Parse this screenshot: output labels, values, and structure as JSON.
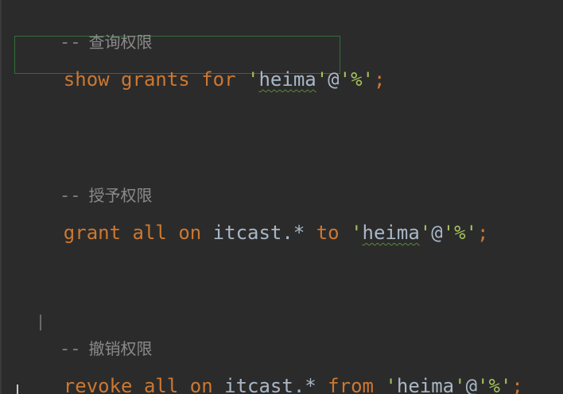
{
  "editor": {
    "lines": [
      {
        "type": "comment",
        "prefix": "--",
        "text": "查询权限"
      },
      {
        "type": "code",
        "tokens": [
          "show",
          "grants",
          "for",
          "heima",
          "%"
        ]
      },
      {
        "type": "comment",
        "prefix": "--",
        "text": "授予权限"
      },
      {
        "type": "code",
        "tokens": [
          "grant",
          "all",
          "on",
          "itcast.*",
          "to",
          "heima",
          "%"
        ]
      },
      {
        "type": "comment",
        "prefix": "--",
        "text": "撤销权限"
      },
      {
        "type": "code",
        "tokens": [
          "revoke",
          "all",
          "on",
          "itcast.*",
          "from",
          "heima",
          "%"
        ]
      }
    ]
  },
  "colors": {
    "background": "#2b2b2b",
    "keyword": "#cc7832",
    "identifier": "#a9b7c6",
    "string": "#a5c25c",
    "comment": "#808080",
    "current_line_border": "#2f6f3a"
  }
}
